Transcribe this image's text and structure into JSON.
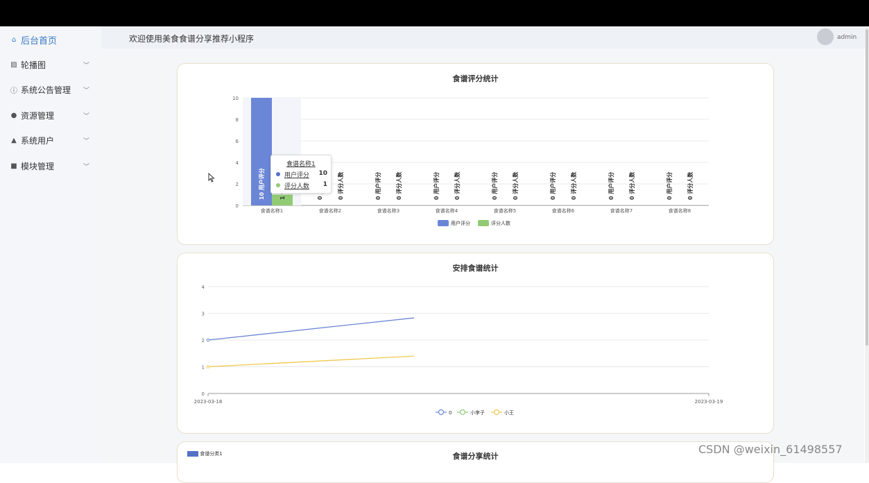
{
  "sidebar": {
    "items": [
      {
        "label": "后台首页",
        "icon": "home-icon",
        "glyph": "⌂"
      },
      {
        "label": "轮播图",
        "icon": "image-icon",
        "glyph": "▨"
      },
      {
        "label": "系统公告管理",
        "icon": "info-icon",
        "glyph": "ⓘ"
      },
      {
        "label": "资源管理",
        "icon": "resource-icon",
        "glyph": "●"
      },
      {
        "label": "系统用户",
        "icon": "user-icon",
        "glyph": "▲"
      },
      {
        "label": "模块管理",
        "icon": "grid-icon",
        "glyph": "■"
      }
    ]
  },
  "header": {
    "welcome": "欢迎使用美食食谱分享推荐小程序",
    "user": "admin"
  },
  "chart1": {
    "title": "食谱评分统计",
    "tooltip": {
      "title": "食谱名称1",
      "rows": [
        {
          "name": "用户评分",
          "value": "10"
        },
        {
          "name": "评分人数",
          "value": "1"
        }
      ]
    }
  },
  "chart2": {
    "title": "安排食谱统计"
  },
  "chart3": {
    "title": "食谱分享统计",
    "legend_first": "食谱分类1"
  },
  "colors": {
    "blue": "#6b86d6",
    "green": "#91cc75",
    "yellow": "#f0c84c",
    "accent": "#3a78c3"
  },
  "chart_data": [
    {
      "type": "bar",
      "title": "食谱评分统计",
      "categories": [
        "食谱名称1",
        "食谱名称2",
        "食谱名称3",
        "食谱名称4",
        "食谱名称5",
        "食谱名称6",
        "食谱名称7",
        "食谱名称8"
      ],
      "series": [
        {
          "name": "用户评分",
          "values": [
            10,
            0,
            0,
            0,
            0,
            0,
            0,
            0
          ]
        },
        {
          "name": "评分人数",
          "values": [
            1,
            0,
            0,
            0,
            0,
            0,
            0,
            0
          ]
        }
      ],
      "ylim": [
        0,
        10
      ],
      "yticks": [
        "0",
        "2",
        "4",
        "6",
        "8",
        "10"
      ],
      "legend": "bottom-center"
    },
    {
      "type": "line",
      "title": "安排食谱统计",
      "x": [
        "2023-03-18",
        "2023-03-19"
      ],
      "series": [
        {
          "name": "0",
          "values": [
            2,
            2.83
          ]
        },
        {
          "name": "小李子",
          "values": [
            null,
            null
          ]
        },
        {
          "name": "小王",
          "values": [
            1,
            1.4
          ]
        }
      ],
      "ylim": [
        0,
        4
      ],
      "yticks": [
        "0",
        "1",
        "2",
        "3",
        "4"
      ],
      "legend": "bottom-center"
    }
  ]
}
